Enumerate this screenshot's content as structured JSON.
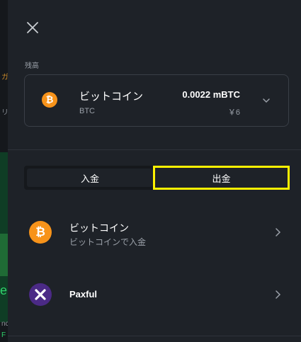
{
  "background_fragments": [
    "ガ",
    "リ",
    "e",
    "nc",
    "F"
  ],
  "panel": {
    "balance_label": "残高",
    "balance": {
      "currency_name": "ビットコイン",
      "currency_symbol": "BTC",
      "amount": "0.0022 mBTC",
      "fiat": "￥6",
      "icon": "bitcoin-icon"
    },
    "tabs": [
      {
        "label": "入金",
        "active": false
      },
      {
        "label": "出金",
        "active": true,
        "highlighted": true
      }
    ],
    "methods": [
      {
        "title": "ビットコイン",
        "subtitle": "ビットコインで入金",
        "icon": "bitcoin-icon"
      },
      {
        "title": "Paxful",
        "subtitle": "",
        "icon": "paxful-icon"
      }
    ]
  },
  "colors": {
    "panel_bg": "#1e2228",
    "bitcoin_orange": "#f7931a",
    "paxful_purple": "#4b2a86",
    "highlight": "#fff200",
    "muted_text": "#9aa0a8"
  }
}
